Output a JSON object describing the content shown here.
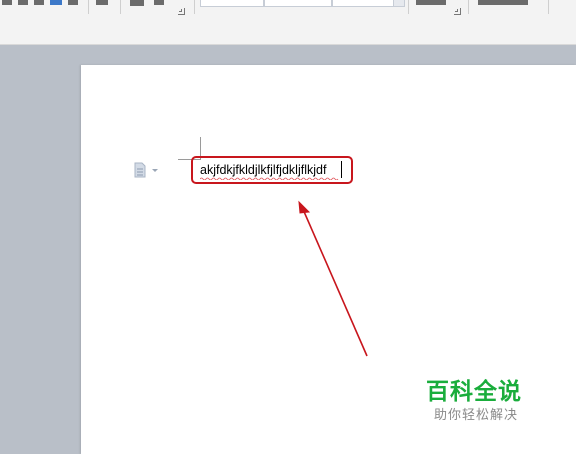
{
  "document": {
    "text": "akjfdkjfkldjlkfjlfjdkljflkjdf"
  },
  "watermark": {
    "title": "百科全说",
    "subtitle": "助你轻松解决"
  },
  "colors": {
    "highlight": "#c8161d",
    "watermark_green": "#1aad3c",
    "workspace": "#b9bfc8"
  },
  "icons": {
    "paragraph_handle": "document-icon",
    "callout": "arrow-icon"
  }
}
